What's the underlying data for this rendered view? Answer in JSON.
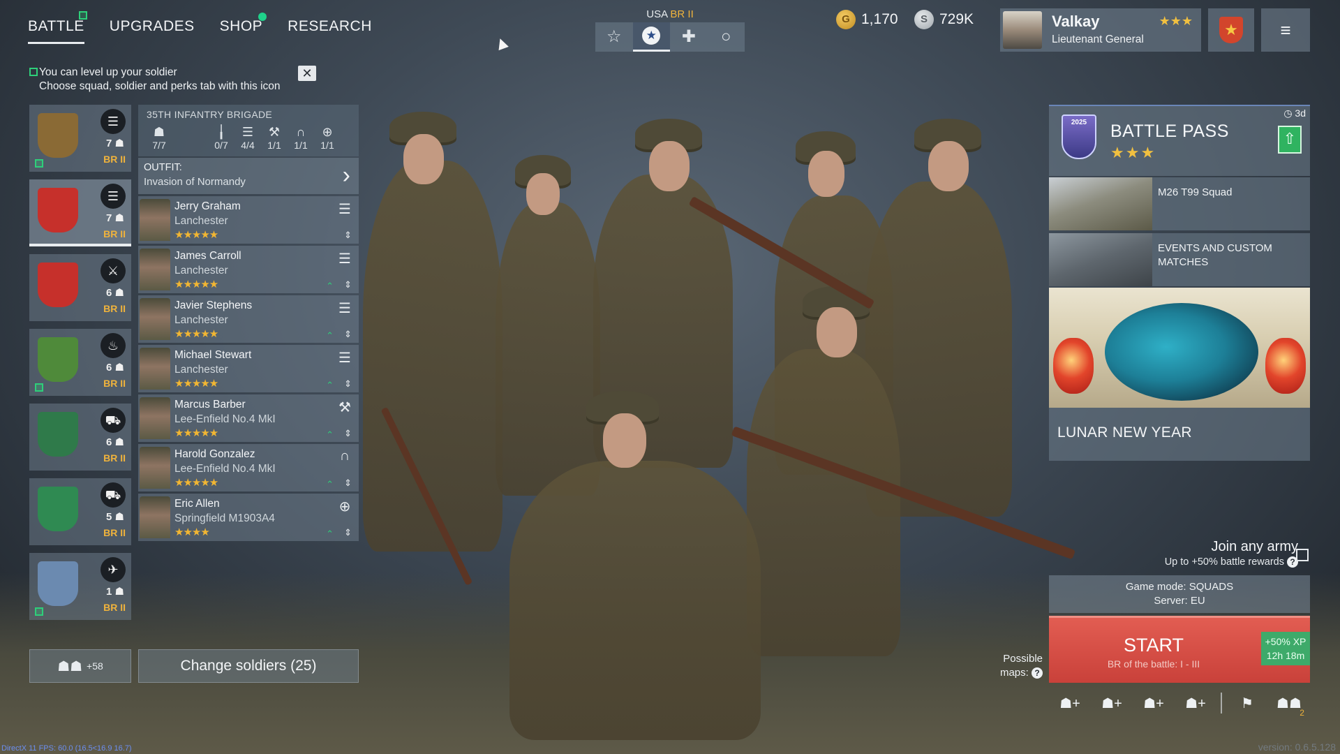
{
  "nav": {
    "tabs": [
      {
        "label": "BATTLE",
        "active": true,
        "indicator": "new-square"
      },
      {
        "label": "UPGRADES",
        "active": false,
        "indicator": null
      },
      {
        "label": "SHOP",
        "active": false,
        "indicator": "green-dot"
      },
      {
        "label": "RESEARCH",
        "active": false,
        "indicator": null
      }
    ]
  },
  "hint": {
    "line1": "You can level up your soldier",
    "line2": "Choose squad, soldier and perks tab with this icon",
    "close_icon": "✕"
  },
  "nation": {
    "country": "USA",
    "br": "BR II"
  },
  "mode_tabs": [
    {
      "icon": "star-outline-icon",
      "glyph": "☆",
      "active": false
    },
    {
      "icon": "star-badge-icon",
      "glyph": "★",
      "active": true
    },
    {
      "icon": "cross-icon",
      "glyph": "✚",
      "active": false
    },
    {
      "icon": "circle-icon",
      "glyph": "○",
      "active": false
    }
  ],
  "currency": {
    "gold": "1,170",
    "gold_symbol": "G",
    "silver": "729K",
    "silver_symbol": "S"
  },
  "profile": {
    "name": "Valkay",
    "rank": "Lieutenant General",
    "rank_stars": "★★★"
  },
  "menu_icon": "≡",
  "squads": [
    {
      "emblem": "eagle-emblem-icon",
      "emblem_color": "#8a6a35",
      "class_icon": "assault-icon",
      "class_glyph": "☰",
      "count": "7",
      "br": "BR II",
      "new": true,
      "selected": false
    },
    {
      "emblem": "cat-emblem-icon",
      "emblem_color": "#c6302b",
      "class_icon": "assault-icon",
      "class_glyph": "☰",
      "count": "7",
      "br": "BR II",
      "new": false,
      "selected": true
    },
    {
      "emblem": "cat-emblem-icon",
      "emblem_color": "#c6302b",
      "class_icon": "knife-icon",
      "class_glyph": "⚔",
      "count": "6",
      "br": "BR II",
      "new": false,
      "selected": false
    },
    {
      "emblem": "tree-emblem-icon",
      "emblem_color": "#4f8a3a",
      "class_icon": "flame-icon",
      "class_glyph": "♨",
      "count": "6",
      "br": "BR II",
      "new": true,
      "selected": false
    },
    {
      "emblem": "shield-emblem-icon",
      "emblem_color": "#2f7a4a",
      "class_icon": "vehicle-icon",
      "class_glyph": "⛟",
      "count": "6",
      "br": "BR II",
      "new": false,
      "selected": false
    },
    {
      "emblem": "panther-emblem-icon",
      "emblem_color": "#2f8a52",
      "class_icon": "vehicle-icon",
      "class_glyph": "⛟",
      "count": "5",
      "br": "BR II",
      "new": false,
      "selected": false
    },
    {
      "emblem": "raf-emblem-icon",
      "emblem_color": "#6b8ab0",
      "class_icon": "plane-icon",
      "class_glyph": "✈",
      "count": "1",
      "br": "BR II",
      "new": true,
      "selected": false
    }
  ],
  "brigade": {
    "name": "35TH INFANTRY BRIGADE",
    "stats": [
      {
        "icon": "soldier-icon",
        "glyph": "☗",
        "value": "7/7"
      },
      {
        "icon": "rifle-icon",
        "glyph": "╽",
        "value": "0/7"
      },
      {
        "icon": "list-icon",
        "glyph": "☰",
        "value": "4/4"
      },
      {
        "icon": "wrench-icon",
        "glyph": "⚒",
        "value": "1/1"
      },
      {
        "icon": "headset-icon",
        "glyph": "∩",
        "value": "1/1"
      },
      {
        "icon": "crosshair-icon",
        "glyph": "⊕",
        "value": "1/1"
      }
    ]
  },
  "outfit": {
    "label": "OUTFIT:",
    "name": "Invasion of Normandy",
    "arrow": "›"
  },
  "soldiers": [
    {
      "name": "Jerry Graham",
      "weapon": "Lanchester",
      "stars": "★★★★★",
      "role_glyph": "☰",
      "up": ""
    },
    {
      "name": "James Carroll",
      "weapon": "Lanchester",
      "stars": "★★★★★",
      "role_glyph": "☰",
      "up": "⌃"
    },
    {
      "name": "Javier Stephens",
      "weapon": "Lanchester",
      "stars": "★★★★★",
      "role_glyph": "☰",
      "up": "⌃"
    },
    {
      "name": "Michael Stewart",
      "weapon": "Lanchester",
      "stars": "★★★★★",
      "role_glyph": "☰",
      "up": "⌃"
    },
    {
      "name": "Marcus Barber",
      "weapon": "Lee-Enfield No.4 MkI",
      "stars": "★★★★★",
      "role_glyph": "⚒",
      "up": "⌃"
    },
    {
      "name": "Harold Gonzalez",
      "weapon": "Lee-Enfield No.4 MkI",
      "stars": "★★★★★",
      "role_glyph": "∩",
      "up": "⌃"
    },
    {
      "name": "Eric Allen",
      "weapon": "Springfield M1903A4",
      "stars": "★★★★",
      "role_glyph": "⊕",
      "up": "⌃"
    }
  ],
  "sort_glyph": "⇕",
  "army_button": {
    "count": "+58",
    "glyph": "☗☗"
  },
  "change_button": "Change soldiers (25)",
  "battle_pass": {
    "title": "BATTLE PASS",
    "stars": "★★★",
    "timer": "3d",
    "emblem_text": "2025",
    "upgrade_glyph": "⇧"
  },
  "side_cards": [
    {
      "title": "M26 T99 Squad"
    },
    {
      "title": "EVENTS AND CUSTOM MATCHES"
    }
  ],
  "event": {
    "title": "LUNAR NEW YEAR"
  },
  "join": {
    "title": "Join any army",
    "subtitle": "Up to +50% battle rewards",
    "q": "?"
  },
  "game_mode": {
    "mode": "Game mode: SQUADS",
    "server": "Server: EU"
  },
  "start": {
    "label": "START",
    "subtitle": "BR of the battle: I - III",
    "xp": "+50% XP",
    "xp_time": "12h 18m"
  },
  "maps": {
    "label1": "Possible",
    "label2": "maps:",
    "q": "?"
  },
  "bottom_icons": [
    {
      "icon": "invite-icon-1",
      "glyph": "☗+"
    },
    {
      "icon": "invite-icon-2",
      "glyph": "☗+"
    },
    {
      "icon": "invite-icon-3",
      "glyph": "☗+"
    },
    {
      "icon": "invite-icon-4",
      "glyph": "☗+"
    },
    {
      "icon": "flag-icon",
      "glyph": "⚑"
    },
    {
      "icon": "group-icon",
      "glyph": "☗☗",
      "count": "2"
    }
  ],
  "debug": {
    "fps": "DirectX 11 FPS: 60.0 (16.5<16.9 16.7)"
  },
  "version": "version: 0.6.5.128"
}
